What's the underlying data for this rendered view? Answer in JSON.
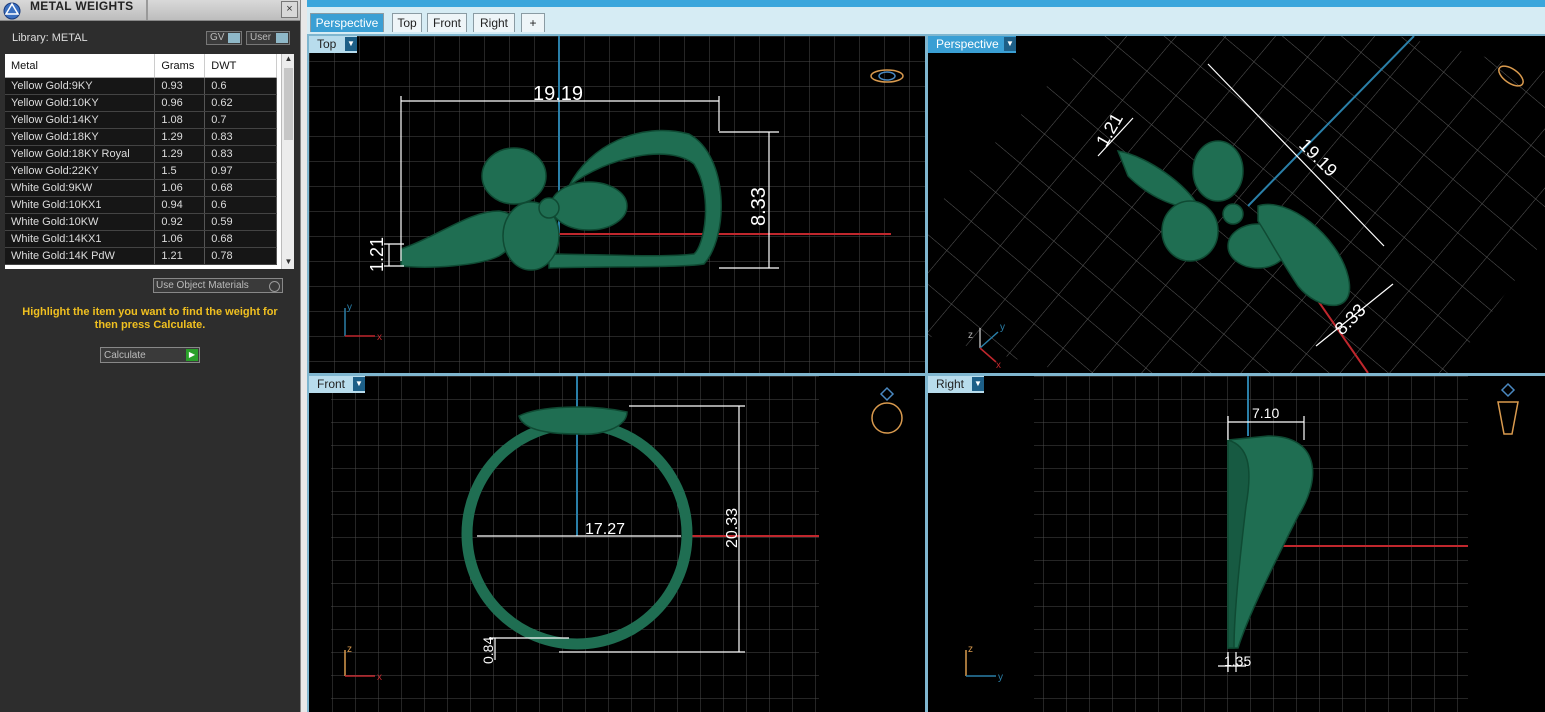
{
  "panel": {
    "title": "METAL WEIGHTS",
    "close": "×",
    "library_label": "Library: METAL",
    "gv_toggle": "GV",
    "user_toggle": "User",
    "use_object_materials": "Use Object Materials",
    "hint": "Highlight the item you want to find the weight for then press Calculate.",
    "calculate": "Calculate"
  },
  "table": {
    "headers": [
      "Metal",
      "Grams",
      "DWT"
    ],
    "rows": [
      [
        "Yellow Gold:9KY",
        "0.93",
        "0.6"
      ],
      [
        "Yellow Gold:10KY",
        "0.96",
        "0.62"
      ],
      [
        "Yellow Gold:14KY",
        "1.08",
        "0.7"
      ],
      [
        "Yellow Gold:18KY",
        "1.29",
        "0.83"
      ],
      [
        "Yellow Gold:18KY Royal",
        "1.29",
        "0.83"
      ],
      [
        "Yellow Gold:22KY",
        "1.5",
        "0.97"
      ],
      [
        "White Gold:9KW",
        "1.06",
        "0.68"
      ],
      [
        "White Gold:10KX1",
        "0.94",
        "0.6"
      ],
      [
        "White Gold:10KW",
        "0.92",
        "0.59"
      ],
      [
        "White Gold:14KX1",
        "1.06",
        "0.68"
      ],
      [
        "White Gold:14K PdW",
        "1.21",
        "0.78"
      ]
    ]
  },
  "tabs": [
    "Perspective",
    "Top",
    "Front",
    "Right",
    "+"
  ],
  "viewports": {
    "top": {
      "label": "Top",
      "dims": [
        "19.19",
        "8.33",
        "1.21"
      ],
      "axis_x": "x",
      "axis_y": "y"
    },
    "perspective": {
      "label": "Perspective",
      "dims": [
        "19.19",
        "8.33",
        "1.21"
      ],
      "axis_x": "x",
      "axis_y": "y",
      "axis_z": "z"
    },
    "front": {
      "label": "Front",
      "dims": [
        "17.27",
        "20.33",
        "0.84"
      ],
      "axis_x": "x",
      "axis_z": "z"
    },
    "right": {
      "label": "Right",
      "dims": [
        "7.10",
        "1.35"
      ],
      "axis_y": "y",
      "axis_z": "z"
    }
  },
  "colors": {
    "model": "#1f6e52",
    "dimension": "#ffffff",
    "axis_x": "#c0272d",
    "axis_y": "#2a7fa8",
    "accent": "#3a9fd4"
  }
}
